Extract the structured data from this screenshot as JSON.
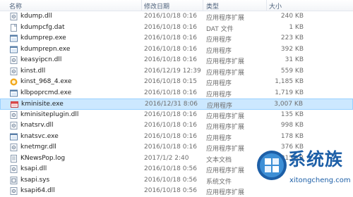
{
  "columns": {
    "name": "名称",
    "date": "修改日期",
    "type": "类型",
    "size": "大小"
  },
  "files": [
    {
      "name": "kdump.dll",
      "date": "2016/10/18 0:16",
      "type": "应用程序扩展",
      "size": "240 KB",
      "icon": "dll-icon"
    },
    {
      "name": "kdumpcfg.dat",
      "date": "2016/10/18 0:16",
      "type": "DAT 文件",
      "size": "1 KB",
      "icon": "file-icon"
    },
    {
      "name": "kdumprep.exe",
      "date": "2016/10/18 0:16",
      "type": "应用程序",
      "size": "223 KB",
      "icon": "exe-icon"
    },
    {
      "name": "kdumprepn.exe",
      "date": "2016/10/18 0:16",
      "type": "应用程序",
      "size": "392 KB",
      "icon": "exe-icon"
    },
    {
      "name": "keasyipcn.dll",
      "date": "2016/10/18 0:16",
      "type": "应用程序扩展",
      "size": "31 KB",
      "icon": "dll-icon"
    },
    {
      "name": "kinst.dll",
      "date": "2016/12/19 12:39",
      "type": "应用程序扩展",
      "size": "559 KB",
      "icon": "dll-icon"
    },
    {
      "name": "kinst_968_4.exe",
      "date": "2016/10/18 0:15",
      "type": "应用程序",
      "size": "1,185 KB",
      "icon": "kingsoft-icon"
    },
    {
      "name": "klbpoprcmd.exe",
      "date": "2016/10/18 0:16",
      "type": "应用程序",
      "size": "1,719 KB",
      "icon": "exe-icon"
    },
    {
      "name": "kminisite.exe",
      "date": "2016/12/31 8:06",
      "type": "应用程序",
      "size": "3,007 KB",
      "icon": "red-exe-icon",
      "selected": true
    },
    {
      "name": "kminisiteplugin.dll",
      "date": "2016/10/18 0:16",
      "type": "应用程序扩展",
      "size": "135 KB",
      "icon": "dll-icon"
    },
    {
      "name": "knatsrv.dll",
      "date": "2016/10/18 0:16",
      "type": "应用程序扩展",
      "size": "998 KB",
      "icon": "dll-icon"
    },
    {
      "name": "knatsvc.exe",
      "date": "2016/10/18 0:16",
      "type": "应用程序",
      "size": "178 KB",
      "icon": "exe-icon"
    },
    {
      "name": "knetmgr.dll",
      "date": "2016/10/18 0:16",
      "type": "应用程序扩展",
      "size": "376 KB",
      "icon": "dll-icon"
    },
    {
      "name": "KNewsPop.log",
      "date": "2017/1/2 2:40",
      "type": "文本文档",
      "size": "215 KB",
      "icon": "text-file-icon"
    },
    {
      "name": "ksapi.dll",
      "date": "2016/10/18 0:56",
      "type": "应用程序扩展",
      "size": "",
      "icon": "dll-icon"
    },
    {
      "name": "ksapi.sys",
      "date": "2016/10/18 0:56",
      "type": "系统文件",
      "size": "",
      "icon": "sys-file-icon"
    },
    {
      "name": "ksapi64.dll",
      "date": "2016/10/18 0:56",
      "type": "应用程序扩展",
      "size": "",
      "icon": "dll-icon"
    }
  ],
  "watermark": {
    "title": "系统族",
    "url": "xitongcheng.com"
  },
  "colors": {
    "selection_bg": "#cce8ff",
    "selection_border": "#99d1ff",
    "watermark_blue": "#1d5fa7"
  }
}
